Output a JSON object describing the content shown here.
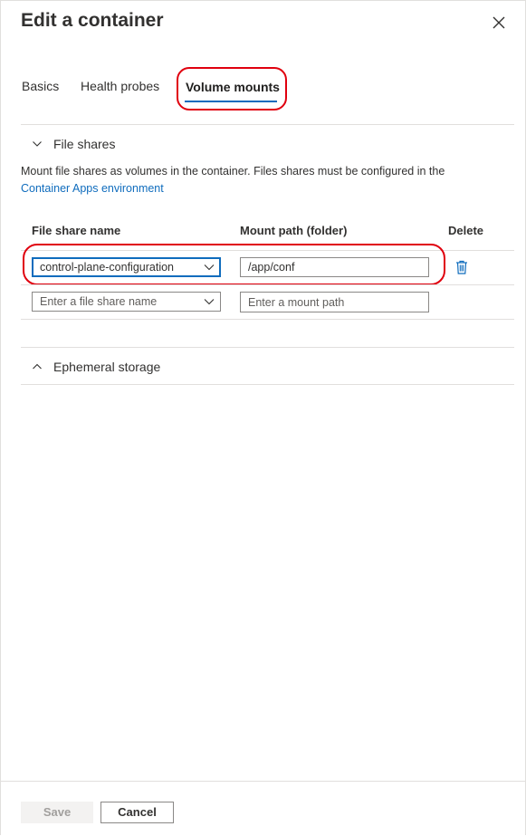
{
  "panel": {
    "title": "Edit a container"
  },
  "tabs": [
    {
      "label": "Basics"
    },
    {
      "label": "Health probes"
    },
    {
      "label": "Volume mounts",
      "selected": true
    }
  ],
  "file_shares": {
    "label": "File shares",
    "expanded": true,
    "description": "Mount file shares as volumes in the container. Files shares must be configured in the",
    "link_text": "Container Apps environment",
    "columns": [
      "File share name",
      "Mount path (folder)",
      "Delete"
    ],
    "rows": [
      {
        "file_share_name": "control-plane-configuration",
        "mount_path": "/app/conf"
      },
      {
        "file_share_placeholder": "Enter a file share name",
        "mount_path_placeholder": "Enter a mount path"
      }
    ]
  },
  "ephemeral_storage": {
    "label": "Ephemeral storage",
    "expanded": false
  },
  "footer": {
    "save_label": "Save",
    "save_disabled": true,
    "cancel_label": "Cancel"
  },
  "colors": {
    "accent": "#0f6cbd",
    "highlight_annotation": "#e0000e"
  },
  "icons": {
    "close": "close-icon",
    "chevron_down": "chevron-down-icon",
    "chevron_up": "chevron-up-icon",
    "trash": "trash-icon"
  }
}
